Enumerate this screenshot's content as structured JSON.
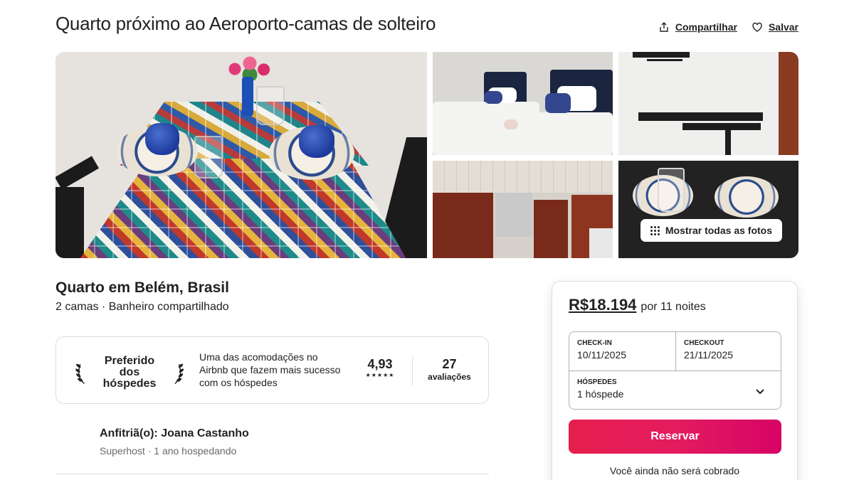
{
  "listing": {
    "title": "Quarto próximo ao Aeroporto-camas de solteiro",
    "share_label": "Compartilhar",
    "save_label": "Salvar"
  },
  "gallery": {
    "show_all_label": "Mostrar todas as fotos"
  },
  "summary": {
    "place_title": "Quarto em Belém, Brasil",
    "details": "2 camas · Banheiro compartilhado"
  },
  "guest_favorite": {
    "badge_line1": "Preferido",
    "badge_line2": "dos hóspedes",
    "description": "Uma das acomodações no Airbnb que fazem mais sucesso com os hóspedes",
    "rating": "4,93",
    "stars": "★★★★★",
    "reviews_count": "27",
    "reviews_label": "avaliações"
  },
  "host": {
    "name": "Anfitriã(o): Joana Castanho",
    "subtitle": "Superhost · 1 ano hospedando"
  },
  "booking": {
    "price": "R$18.194",
    "price_suffix": "por 11 noites",
    "checkin_label": "CHECK-IN",
    "checkin_value": "10/11/2025",
    "checkout_label": "CHECKOUT",
    "checkout_value": "21/11/2025",
    "guests_label": "HÓSPEDES",
    "guests_value": "1 hóspede",
    "reserve_label": "Reservar",
    "not_charged": "Você ainda não será cobrado"
  },
  "colors": {
    "brand": "#e61e4d",
    "text": "#222222",
    "muted": "#6a6a6a",
    "border": "#dddddd"
  }
}
